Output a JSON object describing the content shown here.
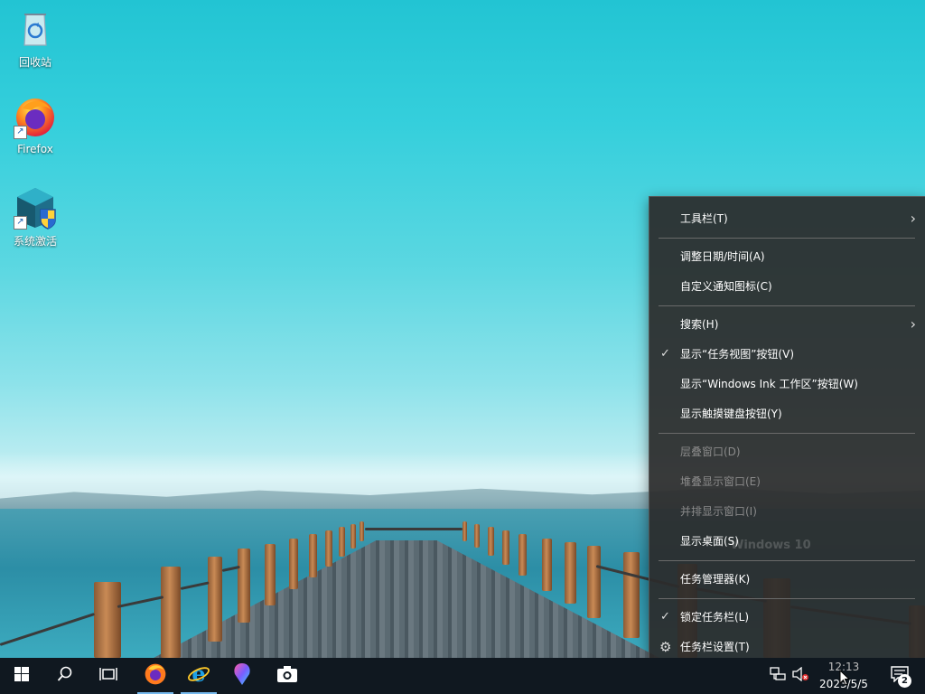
{
  "desktop": {
    "icons": [
      {
        "label": "回收站",
        "icon": "recycle-bin-icon"
      },
      {
        "label": "Firefox",
        "icon": "firefox-icon"
      },
      {
        "label": "系统激活",
        "icon": "system-activation-icon"
      }
    ]
  },
  "context_menu": {
    "items": [
      {
        "label": "工具栏(T)",
        "submenu": true
      },
      {
        "label": "调整日期/时间(A)"
      },
      {
        "label": "自定义通知图标(C)"
      },
      {
        "label": "搜索(H)",
        "submenu": true
      },
      {
        "label": "显示“任务视图”按钮(V)",
        "checked": true
      },
      {
        "label": "显示“Windows Ink 工作区”按钮(W)"
      },
      {
        "label": "显示触摸键盘按钮(Y)"
      },
      {
        "label": "层叠窗口(D)",
        "disabled": true
      },
      {
        "label": "堆叠显示窗口(E)",
        "disabled": true
      },
      {
        "label": "并排显示窗口(I)",
        "disabled": true
      },
      {
        "label": "显示桌面(S)"
      },
      {
        "label": "任务管理器(K)"
      },
      {
        "label": "锁定任务栏(L)",
        "checked": true
      },
      {
        "label": "任务栏设置(T)",
        "gear": true
      }
    ]
  },
  "watermark": {
    "line1": "Windows 10"
  },
  "taskbar": {
    "buttons": [
      "start-icon",
      "search-icon",
      "task-view-icon",
      "firefox-icon",
      "internet-explorer-icon",
      "paint-icon",
      "camera-icon"
    ],
    "tray": {
      "clock_time": "12:13",
      "clock_date": "2023/5/5",
      "notification_count": "2"
    }
  },
  "colors": {
    "accent": "#76b9ed",
    "menu_bg": "#2b2b2b",
    "taskbar_bg": "#101820"
  }
}
